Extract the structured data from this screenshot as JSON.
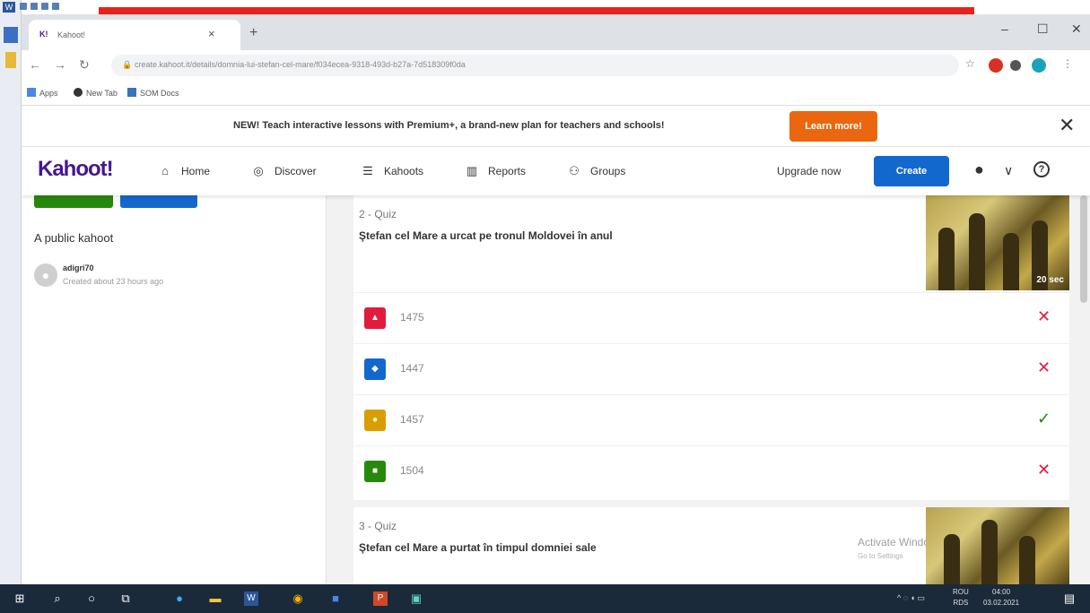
{
  "browser": {
    "tab_title": "Kahoot!",
    "tab_favicon": "K!",
    "url": "create.kahoot.it/details/domnia-lui-stefan-cel-mare/f034ecea-9318-493d-b27a-7d518309f0da",
    "bookmarks": [
      "Apps",
      "New Tab",
      "SOM Docs"
    ]
  },
  "banner": {
    "message": "NEW! Teach interactive lessons with Premium+, a brand-new plan for teachers and schools!",
    "learn_more": "Learn more!"
  },
  "nav": {
    "logo": "Kahoot!",
    "items": [
      "Home",
      "Discover",
      "Kahoots",
      "Reports",
      "Groups"
    ],
    "upgrade": "Upgrade now",
    "create": "Create"
  },
  "sidebar": {
    "visibility": "A public kahoot",
    "username": "adigri70",
    "created": "Created about 23 hours ago"
  },
  "questions": [
    {
      "label": "2 - Quiz",
      "title": "Ştefan cel Mare a urcat pe tronul Moldovei în anul",
      "time": "20 sec",
      "answers": [
        {
          "text": "1475",
          "correct": false
        },
        {
          "text": "1447",
          "correct": false
        },
        {
          "text": "1457",
          "correct": true
        },
        {
          "text": "1504",
          "correct": false
        }
      ]
    },
    {
      "label": "3 - Quiz",
      "title": "Ştefan cel Mare a purtat în timpul domniei sale"
    }
  ],
  "watermark": {
    "line1": "Activate Windows",
    "line2": "Go to Settings"
  },
  "taskbar": {
    "lang": "ROU",
    "lang2": "RDS",
    "time": "04:00",
    "date": "03.02.2021"
  },
  "colors": {
    "kahoot_purple": "#46178f",
    "red": "#e21b3c",
    "blue": "#1368ce",
    "yellow": "#d89e00",
    "green": "#26890c",
    "orange": "#eb670f"
  }
}
